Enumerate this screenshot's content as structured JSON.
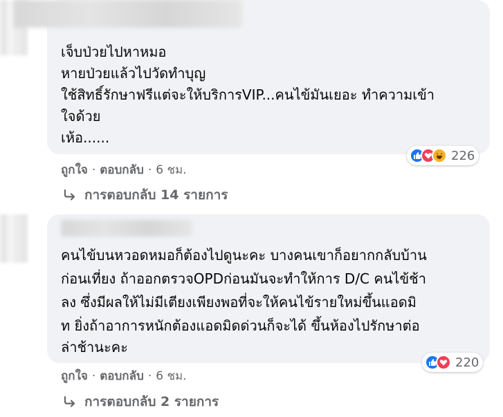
{
  "comments": [
    {
      "lines": [
        "เจ็บป่วยไปหาหมอ",
        "หายป่วยแล้วไปวัดทำบุญ",
        "ใช้สิทธิ์รักษาฟรีแต่จะให้บริการVIP...คนไข้มันเยอะ ทำความเข้า",
        "ใจด้วย",
        "เห้อ......"
      ],
      "reaction_count": "226",
      "reactions": [
        "like-icon",
        "love-icon",
        "haha-icon"
      ],
      "like_label": "ถูกใจ",
      "reply_label": "ตอบกลับ",
      "separator": "·",
      "time": "6 ชม.",
      "replies_label": "การตอบกลับ 14 รายการ"
    },
    {
      "lines": [
        "คนไข้บนหวอดหมอก็ต้องไปดูนะคะ บางคนเขาก็อยากกลับบ้าน",
        "ก่อนเที่ยง ถ้าออกตรวจOPDก่อนมันจะทำให้การ D/C คนไข้ช้า",
        "ลง ซึ่งมีผลให้ไม่มีเตียงเพียงพอที่จะให้คนไข้รายใหม่ขึ้นแอดมิ",
        "ท ยิ่งถ้าอาการหนักต้องแอดมิดด่วนก็จะได้ ขึ้นห้องไปรักษาต่อ",
        "ล่าช้านะคะ"
      ],
      "reaction_count": "220",
      "reactions": [
        "like-icon",
        "love-icon"
      ],
      "like_label": "ถูกใจ",
      "reply_label": "ตอบกลับ",
      "separator": "·",
      "time": "6 ชม.",
      "replies_label": "การตอบกลับ 2 รายการ"
    }
  ],
  "colors": {
    "bubble": "#f0f2f5",
    "meta_text": "#65676b",
    "like": "#1877f2",
    "love": "#f33e58",
    "haha": "#f7b125"
  }
}
